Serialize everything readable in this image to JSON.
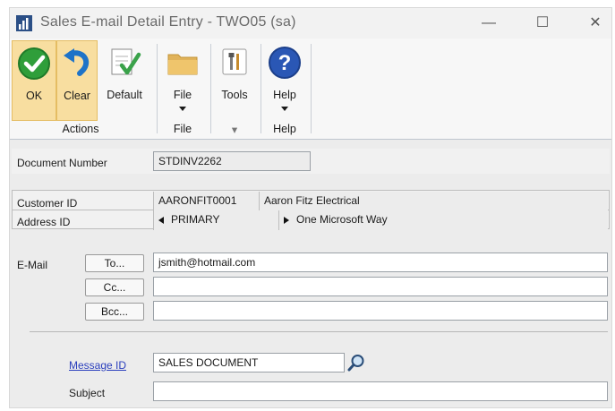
{
  "window": {
    "title": "Sales E-mail Detail Entry  -  TWO05 (sa)",
    "controls": {
      "minimize": "—",
      "maximize": "☐",
      "close": "✕"
    },
    "app_icon": "bar-chart-icon"
  },
  "ribbon": {
    "groups": [
      {
        "name": "Actions",
        "buttons": [
          {
            "label": "OK",
            "icon": "ok-check-icon",
            "selected": true
          },
          {
            "label": "Clear",
            "icon": "undo-arrow-icon",
            "selected": true
          },
          {
            "label": "Default",
            "icon": "default-doc-check-icon",
            "selected": false
          }
        ]
      },
      {
        "name": "File",
        "buttons": [
          {
            "label": "File",
            "icon": "folder-icon",
            "dropdown": true
          }
        ]
      },
      {
        "name": "",
        "buttons": [
          {
            "label": "Tools",
            "icon": "tools-icon"
          }
        ]
      },
      {
        "name": "Help",
        "buttons": [
          {
            "label": "Help",
            "icon": "help-question-icon",
            "dropdown": true
          }
        ]
      }
    ],
    "tools_group_arrow": "▾",
    "accent": "#f8dea0"
  },
  "form": {
    "document_number": {
      "label": "Document Number",
      "value": "STDINV2262"
    },
    "customer_id": {
      "label": "Customer ID",
      "value": "AARONFIT0001",
      "name": "Aaron Fitz Electrical"
    },
    "address_id": {
      "label": "Address ID",
      "value": "PRIMARY",
      "address": "One Microsoft Way"
    },
    "email": {
      "label": "E-Mail",
      "to": {
        "button": "To...",
        "value": "jsmith@hotmail.com"
      },
      "cc": {
        "button": "Cc...",
        "value": ""
      },
      "bcc": {
        "button": "Bcc...",
        "value": ""
      }
    },
    "message_id": {
      "label": "Message ID",
      "value": "SALES DOCUMENT",
      "lookup_icon": "magnifier-icon"
    },
    "subject": {
      "label": "Subject",
      "value": ""
    }
  }
}
